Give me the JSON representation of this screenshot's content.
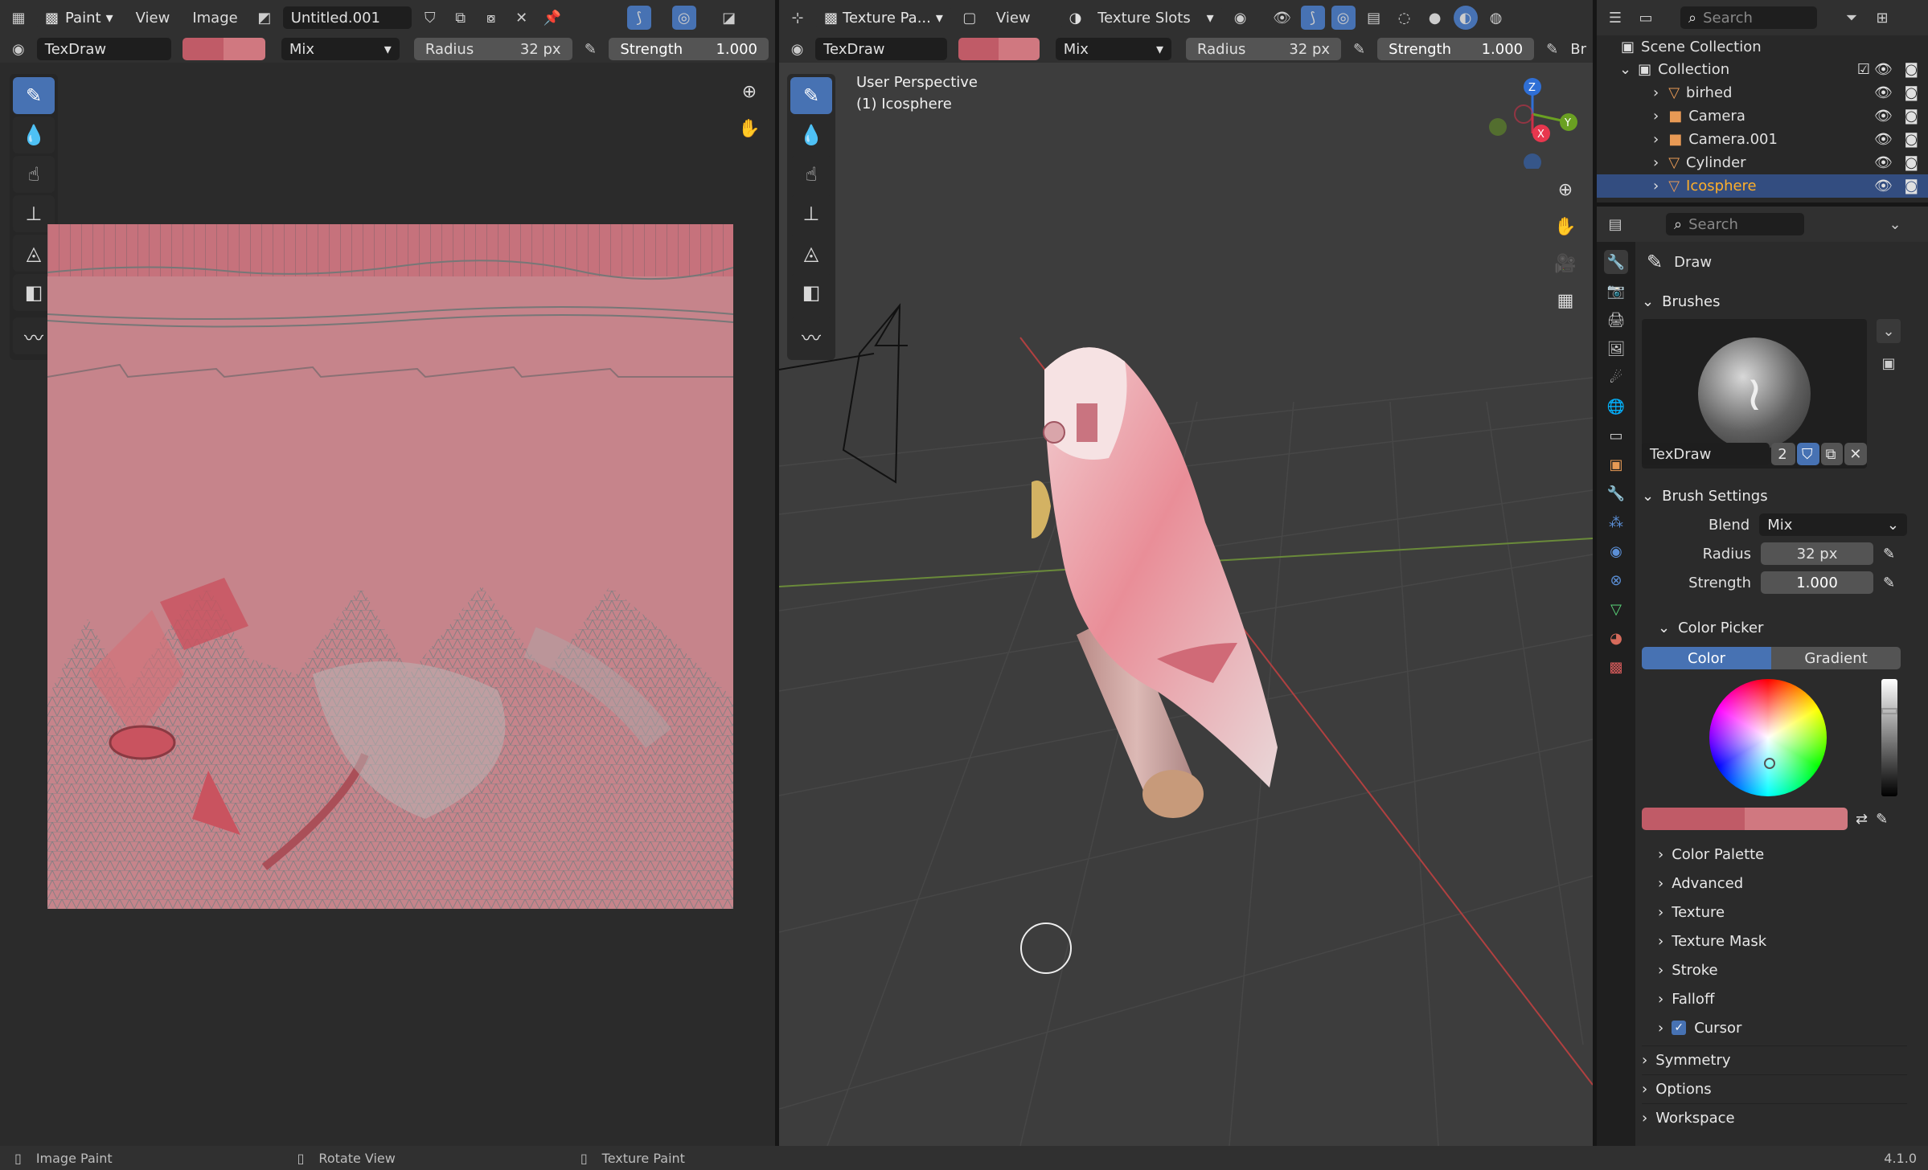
{
  "left_editor": {
    "mode": "Paint",
    "menus": [
      "View",
      "Image"
    ],
    "image_name": "Untitled.001",
    "brush": "TexDraw",
    "blend": "Mix",
    "radius_label": "Radius",
    "radius_value": "32 px",
    "strength_label": "Strength",
    "strength_value": "1.000"
  },
  "viewport": {
    "mode": "Texture Pa...",
    "menu": "View",
    "slots": "Texture Slots",
    "brush": "TexDraw",
    "blend": "Mix",
    "radius_label": "Radius",
    "radius_value": "32 px",
    "strength_label": "Strength",
    "strength_value": "1.000",
    "overflow_label": "Br",
    "perspective": "User Perspective",
    "object": "(1) Icosphere",
    "axes": {
      "x": "X",
      "y": "Y",
      "z": "Z"
    }
  },
  "outliner": {
    "search_placeholder": "Search",
    "scene_collection": "Scene Collection",
    "collection": "Collection",
    "items": [
      {
        "name": "birhed"
      },
      {
        "name": "Camera"
      },
      {
        "name": "Camera.001"
      },
      {
        "name": "Cylinder"
      },
      {
        "name": "Icosphere"
      }
    ]
  },
  "properties": {
    "search_placeholder": "Search",
    "tool_name": "Draw",
    "brushes_label": "Brushes",
    "brush_name": "TexDraw",
    "brush_users": "2",
    "brush_settings_label": "Brush Settings",
    "blend_label": "Blend",
    "blend_value": "Mix",
    "radius_label": "Radius",
    "radius_value": "32 px",
    "strength_label": "Strength",
    "strength_value": "1.000",
    "color_picker_label": "Color Picker",
    "tab_color": "Color",
    "tab_gradient": "Gradient",
    "subpanels": [
      "Color Palette",
      "Advanced",
      "Texture",
      "Texture Mask",
      "Stroke",
      "Falloff",
      "Cursor"
    ],
    "panels": [
      "Symmetry",
      "Options",
      "Workspace"
    ]
  },
  "status": {
    "item1": "Image Paint",
    "item2": "Rotate View",
    "item3": "Texture Paint",
    "version": "4.1.0"
  },
  "colors": {
    "accent": "#4772b3",
    "paint_primary": "#c05b67",
    "paint_secondary": "#d07880",
    "selected_object": "#ffaf29"
  }
}
